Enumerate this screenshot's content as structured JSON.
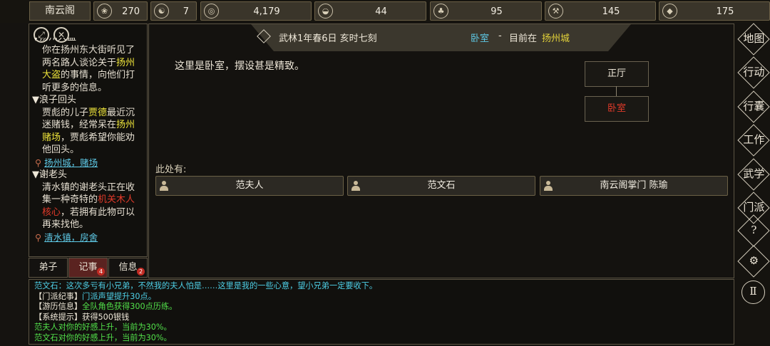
{
  "sect": "南云阁",
  "resources": [
    {
      "icon": "coin-bag-icon",
      "glyph": "❀",
      "value": "270"
    },
    {
      "icon": "yin-yang-icon",
      "glyph": "☯",
      "value": "7"
    },
    {
      "icon": "copper-coin-icon",
      "glyph": "◎",
      "value": "4,179"
    },
    {
      "icon": "rice-bowl-icon",
      "glyph": "◒",
      "value": "44"
    },
    {
      "icon": "herb-icon",
      "glyph": "♣",
      "value": "95"
    },
    {
      "icon": "wood-icon",
      "glyph": "⚒",
      "value": "145"
    },
    {
      "icon": "ore-icon",
      "glyph": "◆",
      "value": "175"
    }
  ],
  "left_panel": {
    "quest_partial_title": "▼扬州大盗",
    "quests": [
      {
        "body": [
          "你在扬州东大街听见了",
          "两名路人谈论关于",
          "扬州",
          "大盗",
          "的事情，向他们打",
          "听更多的信息。"
        ]
      },
      {
        "title": "▼浪子回头",
        "body_1": "贾彪的儿子",
        "hl_1": "贾德",
        "body_2": "最近沉",
        "body_3": "迷赌钱，经常呆在",
        "hl_2": "扬州",
        "hl_3": "赌场",
        "body_4": "，贾彪希望你能劝",
        "body_5": "他回头。",
        "location": "扬州城，赌场"
      },
      {
        "title": "▼谢老头",
        "body_1": "清水镇的谢老头正在收",
        "body_2": "集一种奇特的",
        "hl_1": "机关木人",
        "hl_2": "核心",
        "body_3": "，若拥有此物可以",
        "body_4": "再来找他。",
        "location": "清水镇，房舍"
      }
    ]
  },
  "tabs": [
    {
      "label": "弟子",
      "badge": ""
    },
    {
      "label": "记事",
      "badge": "4"
    },
    {
      "label": "信息",
      "badge": "2"
    }
  ],
  "banner": {
    "date": "武林1年春6日 亥时七刻",
    "room": "卧室",
    "sep": "-",
    "current": "目前在",
    "city": "扬州城"
  },
  "description": "这里是卧室，摆设甚是精致。",
  "minimap": {
    "north": "正厅",
    "current": "卧室"
  },
  "here_label": "此处有:",
  "npcs": [
    "范夫人",
    "范文石",
    "南云阁掌门 陈瑜"
  ],
  "log": [
    {
      "color": "cyan",
      "text": "范文石：这次多亏有小兄弟，不然我的夫人怕是……这里是我的一些心意，望小兄弟一定要收下。"
    },
    {
      "color": "mixed",
      "prefix": "【门派纪事】",
      "text": "门派声望提升30点。"
    },
    {
      "color": "mixed2",
      "prefix": "【游历信息】",
      "text": "全队角色获得300点历练。"
    },
    {
      "color": "white",
      "text": "【系统提示】获得500银钱"
    },
    {
      "color": "green",
      "text": "范夫人对你的好感上升，当前为30%。"
    },
    {
      "color": "green",
      "text": "范文石对你的好感上升，当前为30%。"
    }
  ],
  "sidebar": [
    "地图",
    "行动",
    "行囊",
    "工作",
    "武学",
    "门派",
    "?",
    "⚙",
    "Ⅱ"
  ]
}
